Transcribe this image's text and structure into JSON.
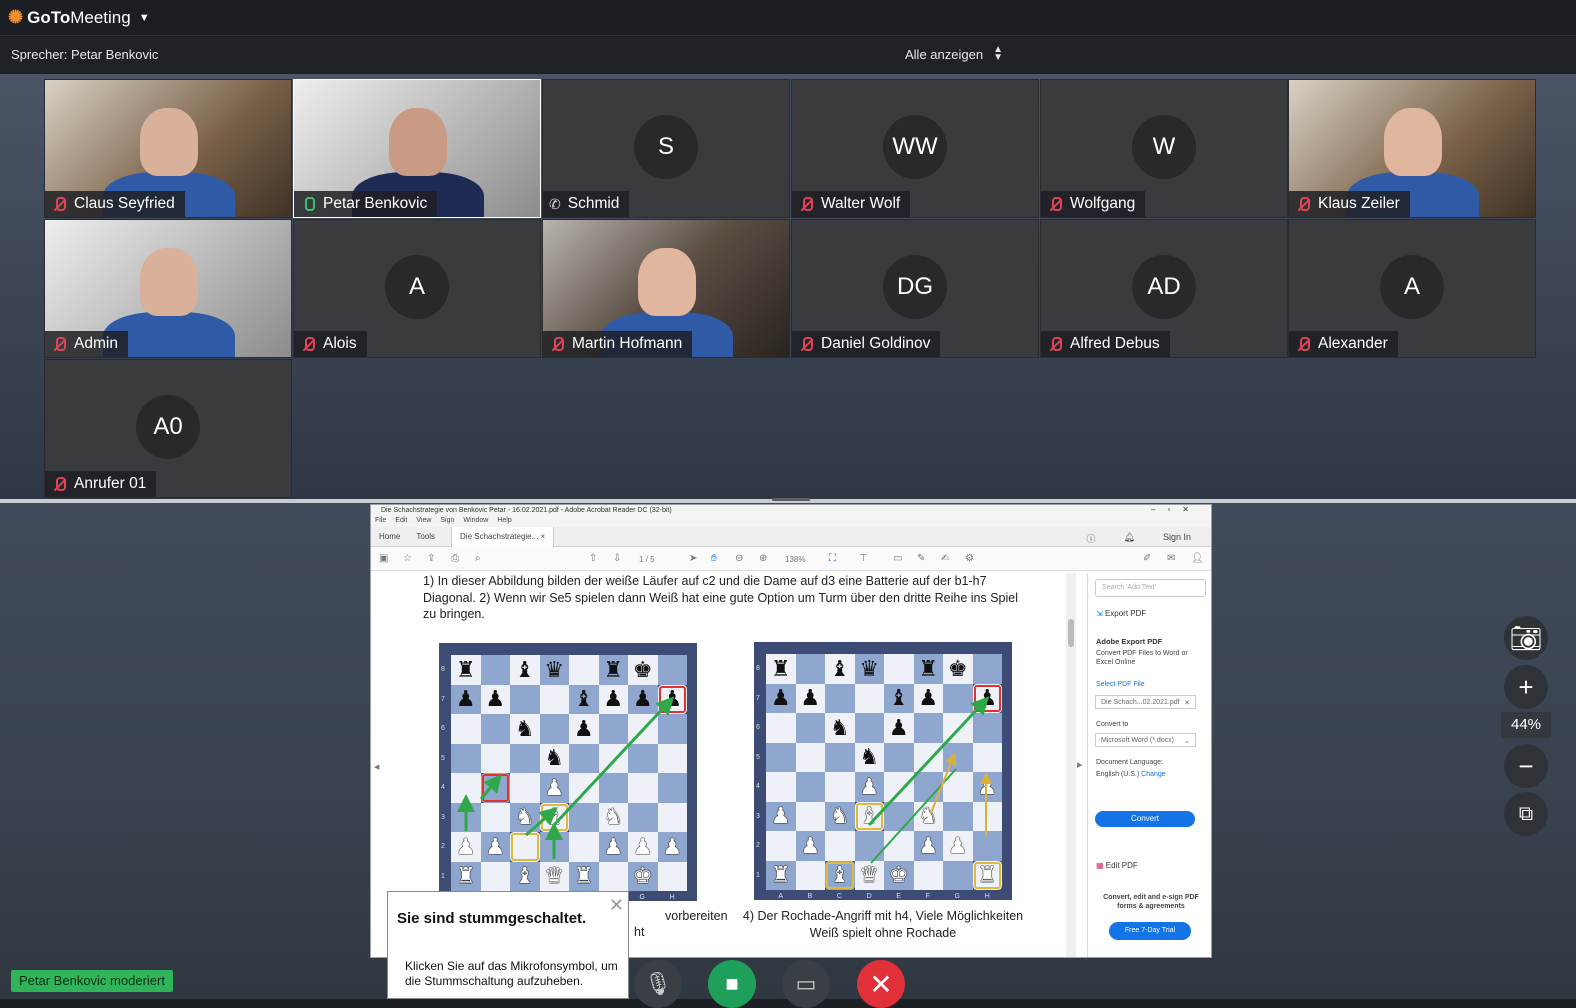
{
  "app": {
    "name_bold": "GoTo",
    "name_light": "Meeting"
  },
  "speaker_bar": {
    "speaker_label": "Sprecher: Petar Benkovic",
    "view_mode": "Alle anzeigen"
  },
  "participants": [
    {
      "name": "Claus Seyfried",
      "initials": "",
      "mic": "muted",
      "video": true
    },
    {
      "name": "Petar Benkovic",
      "initials": "",
      "mic": "speaking",
      "video": true
    },
    {
      "name": "Schmid",
      "initials": "S",
      "mic": "phone",
      "video": false
    },
    {
      "name": "Walter Wolf",
      "initials": "WW",
      "mic": "muted",
      "video": false
    },
    {
      "name": "Wolfgang",
      "initials": "W",
      "mic": "muted",
      "video": false
    },
    {
      "name": "Klaus Zeiler",
      "initials": "",
      "mic": "muted",
      "video": true
    },
    {
      "name": "Admin",
      "initials": "",
      "mic": "muted",
      "video": true
    },
    {
      "name": "Alois",
      "initials": "A",
      "mic": "muted",
      "video": false
    },
    {
      "name": "Martin Hofmann",
      "initials": "",
      "mic": "muted",
      "video": true
    },
    {
      "name": "Daniel Goldinov",
      "initials": "DG",
      "mic": "muted",
      "video": false
    },
    {
      "name": "Alfred Debus",
      "initials": "AD",
      "mic": "muted",
      "video": false
    },
    {
      "name": "Alexander",
      "initials": "A",
      "mic": "muted",
      "video": false
    },
    {
      "name": "Anrufer 01",
      "initials": "A0",
      "mic": "muted",
      "video": false
    }
  ],
  "acrobat": {
    "window_title": "Die Schachstrategie von Benkovic Petar - 16.02.2021.pdf - Adobe Acrobat Reader DC (32-bit)",
    "menu": [
      "File",
      "Edit",
      "View",
      "Sign",
      "Window",
      "Help"
    ],
    "tab_home": "Home",
    "tab_tools": "Tools",
    "tab_doc": "Die Schachstrategie...",
    "sign_in": "Sign In",
    "page_indicator": "1 / 5",
    "zoom": "138%",
    "doc_text": "1)  In dieser Abbildung bilden der weiße Läufer auf c2 und die Dame auf d3 eine Batterie auf der b1-h7 Diagonal.  2)  Wenn wir Se5 spielen dann Weiß hat eine gute Option um Turm über den dritte Reihe ins Spiel zu bringen.",
    "caption_left": "vorbereiten",
    "caption_left_2": "ht",
    "caption_right": "4)  Der Rochade-Angriff mit h4, Viele Möglichkeiten Weiß spielt ohne Rochade",
    "board_files": [
      "A",
      "B",
      "C",
      "D",
      "E",
      "F",
      "G",
      "H"
    ],
    "board_ranks": [
      "8",
      "7",
      "6",
      "5",
      "4",
      "3",
      "2",
      "1"
    ],
    "board_left": [
      "r . b q . r k .",
      "p p . . b p p p",
      ". . n . p . . .",
      ". . . n . . . .",
      ". . . P . . . .",
      ". . N B . N . .",
      "P P . . . P P P",
      "R . B Q R . K ."
    ],
    "board_right": [
      "r . b q . r k .",
      "p p . . b p . p",
      ". . n . p . . .",
      ". . . n . . . .",
      ". . . P . . . P",
      "P . N B . N . .",
      ". P . . . P P .",
      "R . B Q K . . R"
    ],
    "right_pane": {
      "search_placeholder": "Search 'Add Text'",
      "export_pdf": "Export PDF",
      "adobe_export": "Adobe Export PDF",
      "convert_desc": "Convert PDF Files to Word or Excel Online",
      "select_file": "Select PDF File",
      "file_name": "Die Schach...02.2021.pdf",
      "convert_to": "Convert to",
      "format": "Microsoft Word (*.docx)",
      "doc_language": "Document Language:",
      "language": "English (U.S.)",
      "change": "Change",
      "convert_button": "Convert",
      "edit_pdf": "Edit PDF",
      "promo": "Convert, edit and e-sign PDF forms & agreements",
      "trial_button": "Free 7-Day Trial"
    }
  },
  "side_controls": {
    "zoom_level": "44%"
  },
  "muted_toast": {
    "title": "Sie sind stummgeschaltet.",
    "body": "Klicken Sie auf das Mikrofonsymbol, um die Stummschaltung aufzuheben."
  },
  "moderator_badge": "Petar Benkovic moderiert",
  "colors": {
    "brand": "#f68d2e",
    "muted_red": "#e04456",
    "speaking_green": "#3fc06a",
    "end_call": "#e0303a",
    "camera_on": "#1fa05a",
    "moderator": "#2fb45a"
  }
}
